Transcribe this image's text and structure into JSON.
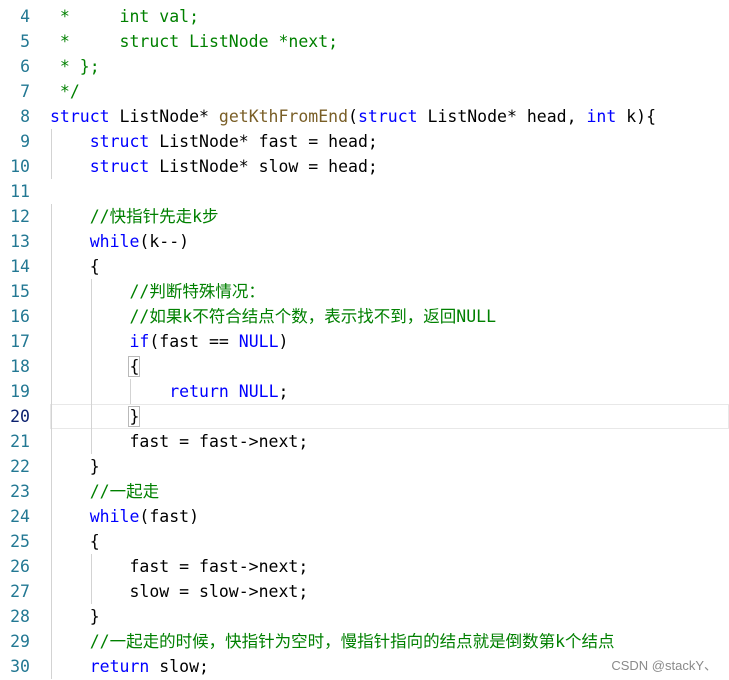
{
  "editor": {
    "lines": [
      {
        "num": "4",
        "tokens": [
          {
            "t": "cm",
            "v": " *     int val;"
          }
        ]
      },
      {
        "num": "5",
        "tokens": [
          {
            "t": "cm",
            "v": " *     struct ListNode *next;"
          }
        ]
      },
      {
        "num": "6",
        "tokens": [
          {
            "t": "cm",
            "v": " * };"
          }
        ]
      },
      {
        "num": "7",
        "tokens": [
          {
            "t": "cm",
            "v": " */"
          }
        ]
      },
      {
        "num": "8",
        "tokens": [
          {
            "t": "kw",
            "v": "struct"
          },
          {
            "t": "p",
            "v": " ListNode* "
          },
          {
            "t": "fn",
            "v": "getKthFromEnd"
          },
          {
            "t": "p",
            "v": "("
          },
          {
            "t": "kw",
            "v": "struct"
          },
          {
            "t": "p",
            "v": " ListNode* head, "
          },
          {
            "t": "kw",
            "v": "int"
          },
          {
            "t": "p",
            "v": " k){"
          }
        ]
      },
      {
        "num": "9",
        "tokens": [
          {
            "t": "p",
            "v": "    "
          },
          {
            "t": "kw",
            "v": "struct"
          },
          {
            "t": "p",
            "v": " ListNode* fast = head;"
          }
        ]
      },
      {
        "num": "10",
        "tokens": [
          {
            "t": "p",
            "v": "    "
          },
          {
            "t": "kw",
            "v": "struct"
          },
          {
            "t": "p",
            "v": " ListNode* slow = head;"
          }
        ]
      },
      {
        "num": "11",
        "tokens": []
      },
      {
        "num": "12",
        "tokens": [
          {
            "t": "p",
            "v": "    "
          },
          {
            "t": "cm",
            "v": "//快指针先走k步"
          }
        ]
      },
      {
        "num": "13",
        "tokens": [
          {
            "t": "p",
            "v": "    "
          },
          {
            "t": "kw",
            "v": "while"
          },
          {
            "t": "p",
            "v": "(k--)"
          }
        ]
      },
      {
        "num": "14",
        "tokens": [
          {
            "t": "p",
            "v": "    {"
          }
        ]
      },
      {
        "num": "15",
        "tokens": [
          {
            "t": "p",
            "v": "        "
          },
          {
            "t": "cm",
            "v": "//判断特殊情况："
          }
        ]
      },
      {
        "num": "16",
        "tokens": [
          {
            "t": "p",
            "v": "        "
          },
          {
            "t": "cm",
            "v": "//如果k不符合结点个数，表示找不到，返回NULL"
          }
        ]
      },
      {
        "num": "17",
        "tokens": [
          {
            "t": "p",
            "v": "        "
          },
          {
            "t": "kw",
            "v": "if"
          },
          {
            "t": "p",
            "v": "(fast == "
          },
          {
            "t": "kw",
            "v": "NULL"
          },
          {
            "t": "p",
            "v": ")"
          }
        ]
      },
      {
        "num": "18",
        "tokens": [
          {
            "t": "p",
            "v": "        "
          },
          {
            "t": "br",
            "v": "{"
          }
        ]
      },
      {
        "num": "19",
        "tokens": [
          {
            "t": "p",
            "v": "            "
          },
          {
            "t": "kw",
            "v": "return"
          },
          {
            "t": "p",
            "v": " "
          },
          {
            "t": "kw",
            "v": "NULL"
          },
          {
            "t": "p",
            "v": ";"
          }
        ]
      },
      {
        "num": "20",
        "tokens": [
          {
            "t": "p",
            "v": "        "
          },
          {
            "t": "br",
            "v": "}"
          }
        ],
        "current": true
      },
      {
        "num": "21",
        "tokens": [
          {
            "t": "p",
            "v": "        fast = fast->next;"
          }
        ]
      },
      {
        "num": "22",
        "tokens": [
          {
            "t": "p",
            "v": "    }"
          }
        ]
      },
      {
        "num": "23",
        "tokens": [
          {
            "t": "p",
            "v": "    "
          },
          {
            "t": "cm",
            "v": "//一起走"
          }
        ]
      },
      {
        "num": "24",
        "tokens": [
          {
            "t": "p",
            "v": "    "
          },
          {
            "t": "kw",
            "v": "while"
          },
          {
            "t": "p",
            "v": "(fast)"
          }
        ]
      },
      {
        "num": "25",
        "tokens": [
          {
            "t": "p",
            "v": "    {"
          }
        ]
      },
      {
        "num": "26",
        "tokens": [
          {
            "t": "p",
            "v": "        fast = fast->next;"
          }
        ]
      },
      {
        "num": "27",
        "tokens": [
          {
            "t": "p",
            "v": "        slow = slow->next;"
          }
        ]
      },
      {
        "num": "28",
        "tokens": [
          {
            "t": "p",
            "v": "    }"
          }
        ]
      },
      {
        "num": "29",
        "tokens": [
          {
            "t": "p",
            "v": "    "
          },
          {
            "t": "cm",
            "v": "//一起走的时候，快指针为空时，慢指针指向的结点就是倒数第k个结点"
          }
        ]
      },
      {
        "num": "30",
        "tokens": [
          {
            "t": "p",
            "v": "    "
          },
          {
            "t": "kw",
            "v": "return"
          },
          {
            "t": "p",
            "v": " slow;"
          }
        ]
      }
    ]
  },
  "watermark": "CSDN @stackY、",
  "colors": {
    "keyword": "#0000ff",
    "comment": "#008000",
    "function": "#795e26",
    "line_number": "#237893"
  }
}
